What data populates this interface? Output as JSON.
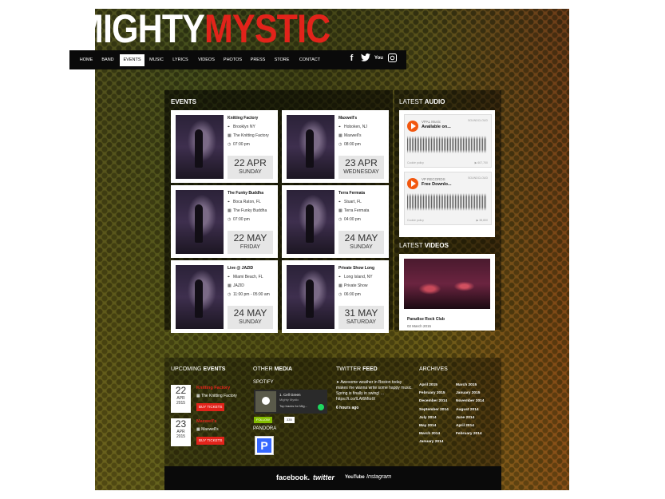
{
  "logo": {
    "part1": "MIGHTY",
    "part2": "MYSTIC"
  },
  "nav": {
    "items": [
      "HOME",
      "BAND",
      "EVENTS",
      "MUSIC",
      "LYRICS",
      "VIDEOS",
      "PHOTOS",
      "PRESS",
      "STORE",
      "CONTACT"
    ],
    "active": "EVENTS",
    "social_icons": [
      "facebook-icon",
      "twitter-icon",
      "youtube-icon",
      "instagram-icon"
    ]
  },
  "events": {
    "title_prefix": "",
    "title_bold": "EVENTS",
    "cards": [
      {
        "name": "Knitting Factory",
        "location": "Brooklyn NY",
        "venue": "The Knitting Factory",
        "time": "07:00 pm",
        "date": "22 APR",
        "weekday": "SUNDAY"
      },
      {
        "name": "Maxwell's",
        "location": "Hoboken, NJ",
        "venue": "Maxwell's",
        "time": "08:00 pm",
        "date": "23 APR",
        "weekday": "WEDNESDAY"
      },
      {
        "name": "The Funky Buddha",
        "location": "Boca Raton, FL",
        "venue": "The Funky Buddha",
        "time": "07:00 pm",
        "date": "22 MAY",
        "weekday": "FRIDAY"
      },
      {
        "name": "Terra Fermata",
        "location": "Stuart, FL",
        "venue": "Terra Fermata",
        "time": "04:00 pm",
        "date": "24 MAY",
        "weekday": "SUNDAY"
      },
      {
        "name": "Live @ JAZID",
        "location": "Miami Beach, FL",
        "venue": "JAZID",
        "time": "11:00 pm - 05:00 am",
        "date": "24 MAY",
        "weekday": "SUNDAY"
      },
      {
        "name": "Private Show Long",
        "location": "Long Island, NY",
        "venue": "Private Show",
        "time": "06:00 pm",
        "date": "31 MAY",
        "weekday": "SATURDAY"
      }
    ]
  },
  "latest_audio": {
    "title_prefix": "LATEST ",
    "title_bold": "AUDIO",
    "players": [
      {
        "artist": "VPAL Music",
        "track": "Available on...",
        "brand": "SOUNDCLOUD",
        "footer": "Cookie policy",
        "count": "▶ 607,700"
      },
      {
        "artist": "VP RECORDS",
        "track": "Free Downlo...",
        "brand": "SOUNDCLOUD",
        "footer": "Cookie policy",
        "count": "▶ 38,800"
      }
    ]
  },
  "latest_videos": {
    "title_prefix": "LATEST ",
    "title_bold": "VIDEOS",
    "video_title": "Paradise Rock Club",
    "video_date": "02 March 2015"
  },
  "upcoming": {
    "title_prefix": "UPCOMING ",
    "title_bold": "EVENTS",
    "items": [
      {
        "day": "22",
        "month": "APR",
        "year": "2015",
        "name": "Knitting Factory",
        "venue": "The Knitting Factory",
        "button": "BUY TICKETS"
      },
      {
        "day": "23",
        "month": "APR",
        "year": "2015",
        "name": "Maxwell's",
        "venue": "Maxwell's",
        "button": "BUY TICKETS"
      }
    ]
  },
  "other_media": {
    "title_prefix": "OTHER ",
    "title_bold": "MEDIA",
    "spotify_label": "SPOTIFY",
    "spotify_track": "1. Cell Green",
    "spotify_artist": "Mighty Mystic",
    "spotify_play": "Top tracks for Mig...",
    "follow_label": "FOLLOW",
    "follow_count": "335",
    "pandora_label": "PANDORA",
    "pandora_icon": "P"
  },
  "twitter": {
    "title_prefix": "TWITTER ",
    "title_bold": "FEED",
    "tweet": "Awesome weather in Boston today makes me wanna write some happy music. Spring is finally in swing! ... https://t.co/ILAI6MtoIX",
    "time": "6 hours ago"
  },
  "archives": {
    "title": "ARCHIVES",
    "col1": [
      "April 2015",
      "February 2015",
      "December 2014",
      "September 2014",
      "July 2014",
      "May 2014",
      "March 2014",
      "January 2014"
    ],
    "col2": [
      "March 2015",
      "January 2015",
      "November 2014",
      "August 2014",
      "June 2014",
      "April 2014",
      "February 2014"
    ]
  },
  "footer": {
    "facebook": "facebook.",
    "twitter": "twitter",
    "youtube": "YouTube",
    "instagram": "Instagram"
  }
}
